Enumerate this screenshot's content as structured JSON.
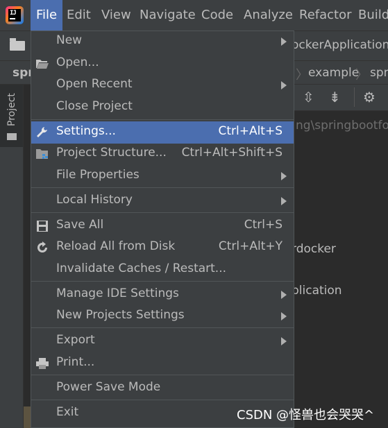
{
  "menubar": {
    "items": [
      "File",
      "Edit",
      "View",
      "Navigate",
      "Code",
      "Analyze",
      "Refactor",
      "Build"
    ],
    "active": "File",
    "logo_text": "IJ"
  },
  "toolbar": {
    "run_config": "ockerApplication"
  },
  "breadcrumb": {
    "project": "spr",
    "items": [
      "example",
      "spr"
    ]
  },
  "toolwindow": {
    "project_label": "Project"
  },
  "editor": {
    "path_text": "ng\\springbootfo",
    "tree_item_1": "rdocker",
    "tree_item_2": "plication"
  },
  "filemenu": {
    "items": [
      {
        "label": "New",
        "submenu": true
      },
      {
        "label": "Open...",
        "icon": "folder-open-icon"
      },
      {
        "label": "Open Recent",
        "submenu": true
      },
      {
        "label": "Close Project"
      },
      {
        "label": "Settings...",
        "shortcut": "Ctrl+Alt+S",
        "icon": "wrench-icon",
        "selected": true
      },
      {
        "label": "Project Structure...",
        "shortcut": "Ctrl+Alt+Shift+S",
        "icon": "project-structure-icon"
      },
      {
        "label": "File Properties",
        "submenu": true
      },
      {
        "label": "Local History",
        "submenu": true
      },
      {
        "label": "Save All",
        "shortcut": "Ctrl+S",
        "icon": "floppy-icon"
      },
      {
        "label": "Reload All from Disk",
        "shortcut": "Ctrl+Alt+Y",
        "icon": "reload-icon"
      },
      {
        "label": "Invalidate Caches / Restart..."
      },
      {
        "label": "Manage IDE Settings",
        "submenu": true
      },
      {
        "label": "New Projects Settings",
        "submenu": true
      },
      {
        "label": "Export",
        "submenu": true
      },
      {
        "label": "Print...",
        "icon": "printer-icon"
      },
      {
        "label": "Power Save Mode"
      },
      {
        "label": "Exit"
      }
    ]
  },
  "watermark": "CSDN @怪兽也会哭哭^",
  "colors": {
    "selection": "#4b6eaf",
    "menu_bg": "#3c3f41",
    "text": "#bbbbbb"
  }
}
